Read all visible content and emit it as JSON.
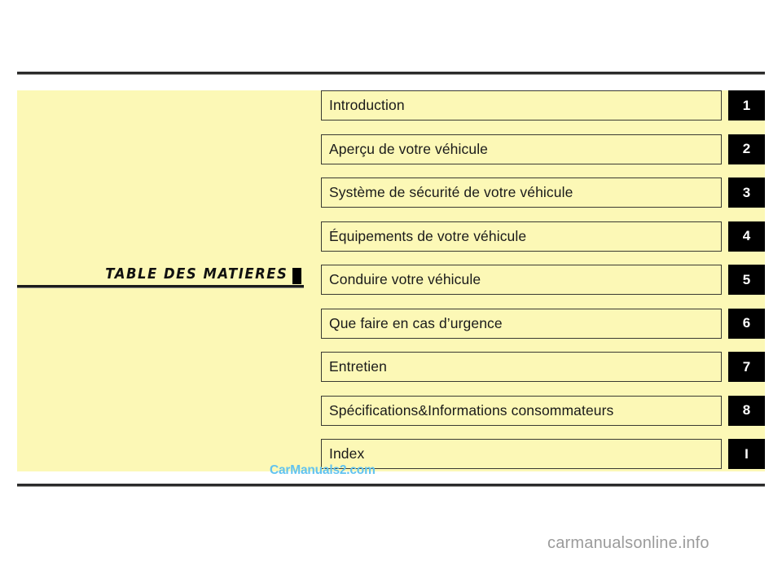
{
  "page": {
    "background_color": "#ffffff",
    "panel_color": "#fcf8b6",
    "accent_color": "#000000"
  },
  "heading": {
    "title": "TABLE  DES  MATIERES",
    "marker": "square-marker"
  },
  "toc": {
    "rows": [
      {
        "label": "Introduction",
        "tab": "1"
      },
      {
        "label": "Aperçu de votre véhicule",
        "tab": "2"
      },
      {
        "label": "Système de sécurité de votre véhicule",
        "tab": "3"
      },
      {
        "label": "Équipements de votre véhicule",
        "tab": "4"
      },
      {
        "label": "Conduire votre véhicule",
        "tab": "5"
      },
      {
        "label": "Que faire en cas d’urgence",
        "tab": "6"
      },
      {
        "label": "Entretien",
        "tab": "7"
      },
      {
        "label": "Spécifications&Informations consommateurs",
        "tab": "8"
      },
      {
        "label": "Index",
        "tab": "I"
      }
    ]
  },
  "watermarks": {
    "inner": "CarManuals2.com",
    "outer": "carmanualsonline.info"
  }
}
